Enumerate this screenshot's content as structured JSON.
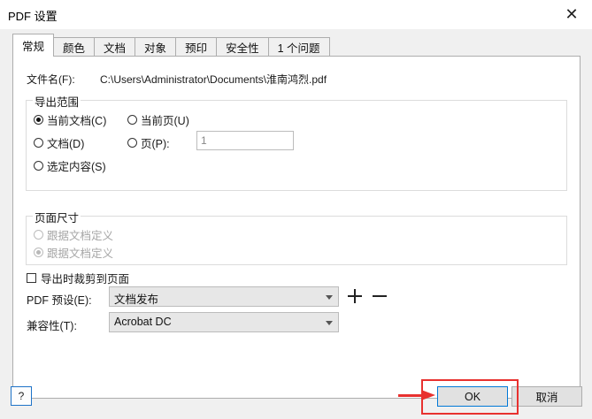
{
  "window": {
    "title": "PDF 设置"
  },
  "tabs": [
    {
      "label": "常规",
      "active": true
    },
    {
      "label": "颜色"
    },
    {
      "label": "文档"
    },
    {
      "label": "对象"
    },
    {
      "label": "预印"
    },
    {
      "label": "安全性"
    },
    {
      "label": "1 个问题"
    }
  ],
  "general": {
    "filename_label": "文件名(F):",
    "filename_value": "C:\\Users\\Administrator\\Documents\\淮南鸿烈.pdf",
    "export_range": {
      "title": "导出范围",
      "current_doc": "当前文档(C)",
      "current_page": "当前页(U)",
      "documents": "文档(D)",
      "pages": "页(P):",
      "pages_value": "1",
      "selection": "选定内容(S)",
      "selected": "current_doc"
    },
    "page_size": {
      "title": "页面尺寸",
      "option1": "跟据文档定义",
      "option2": "跟据文档定义"
    },
    "crop_label": "导出时裁剪到页面",
    "preset_label": "PDF 预设(E):",
    "preset_value": "文档发布",
    "compat_label": "兼容性(T):",
    "compat_value": "Acrobat DC"
  },
  "footer": {
    "help_label": "?",
    "ok_label": "OK",
    "cancel_label": "取消"
  },
  "annotation": {
    "color": "#e8312f"
  }
}
